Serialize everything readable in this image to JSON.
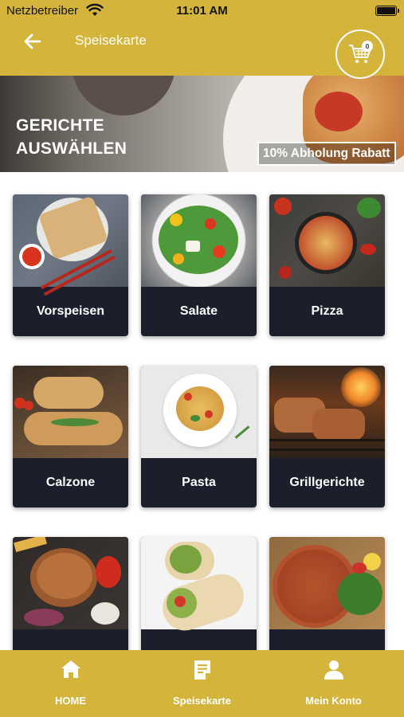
{
  "status_bar": {
    "carrier": "Netzbetreiber",
    "time": "11:01 AM"
  },
  "header": {
    "title": "Speisekarte",
    "back_icon": "arrow-left-icon",
    "cart_icon": "shopping-cart-icon",
    "cart_count": "0"
  },
  "banner": {
    "title": "GERICHTE AUSWÄHLEN",
    "discount": "10% Abholung Rabatt"
  },
  "categories": [
    {
      "label": "Vorspeisen"
    },
    {
      "label": "Salate"
    },
    {
      "label": "Pizza"
    },
    {
      "label": "Calzone"
    },
    {
      "label": "Pasta"
    },
    {
      "label": "Grillgerichte"
    },
    {
      "label": ""
    },
    {
      "label": ""
    },
    {
      "label": ""
    }
  ],
  "bottom_nav": [
    {
      "label": "HOME",
      "icon": "home-icon"
    },
    {
      "label": "Speisekarte",
      "icon": "menu-card-icon"
    },
    {
      "label": "Mein Konto",
      "icon": "user-icon"
    }
  ],
  "colors": {
    "accent": "#d4b43a",
    "card_label_bg": "#1b1f2b",
    "text_light": "#ffffff"
  }
}
